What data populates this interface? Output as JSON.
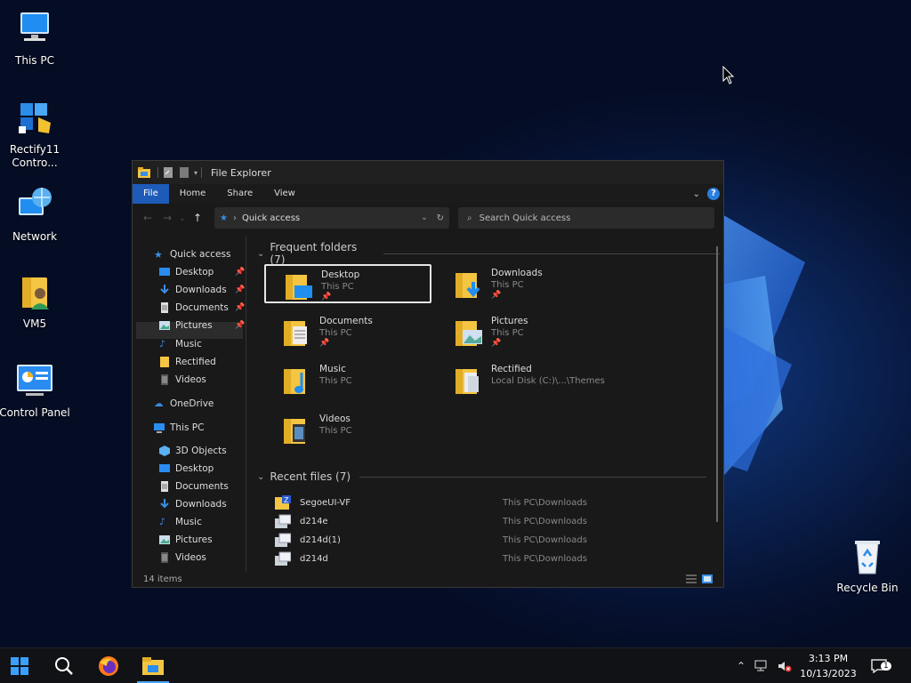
{
  "desktop": {
    "icons": [
      {
        "label": "This PC",
        "icon": "this-pc-icon"
      },
      {
        "label": "Rectify11 Contro...",
        "icon": "rectify11-control-center-icon"
      },
      {
        "label": "Network",
        "icon": "network-icon"
      },
      {
        "label": "VM5",
        "icon": "user-folder-icon"
      },
      {
        "label": "Control Panel",
        "icon": "control-panel-icon"
      },
      {
        "label": "Recycle Bin",
        "icon": "recycle-bin-icon"
      }
    ]
  },
  "explorer": {
    "title": "File Explorer",
    "ribbon_tabs": [
      "File",
      "Home",
      "Share",
      "View"
    ],
    "address": {
      "location": "Quick access"
    },
    "search": {
      "placeholder": "Search Quick access"
    },
    "nav": {
      "quick_access": "Quick access",
      "quick_items": [
        "Desktop",
        "Downloads",
        "Documents",
        "Pictures",
        "Music",
        "Rectified",
        "Videos"
      ],
      "onedrive": "OneDrive",
      "this_pc": "This PC",
      "this_pc_items": [
        "3D Objects",
        "Desktop",
        "Documents",
        "Downloads",
        "Music",
        "Pictures",
        "Videos"
      ]
    },
    "frequent": {
      "header": "Frequent folders (7)",
      "folders": [
        {
          "name": "Desktop",
          "location": "This PC",
          "pinned": true
        },
        {
          "name": "Downloads",
          "location": "This PC",
          "pinned": true
        },
        {
          "name": "Documents",
          "location": "This PC",
          "pinned": true
        },
        {
          "name": "Pictures",
          "location": "This PC",
          "pinned": true
        },
        {
          "name": "Music",
          "location": "This PC",
          "pinned": false
        },
        {
          "name": "Rectified",
          "location": "Local Disk (C:)\\...\\Themes",
          "pinned": false
        },
        {
          "name": "Videos",
          "location": "This PC",
          "pinned": false
        }
      ]
    },
    "recent": {
      "header": "Recent files (7)",
      "files": [
        {
          "name": "SegoeUI-VF",
          "path": "This PC\\Downloads"
        },
        {
          "name": "d214e",
          "path": "This PC\\Downloads"
        },
        {
          "name": "d214d(1)",
          "path": "This PC\\Downloads"
        },
        {
          "name": "d214d",
          "path": "This PC\\Downloads"
        }
      ]
    },
    "status": "14 items"
  },
  "taskbar": {
    "time": "3:13 PM",
    "date": "10/13/2023",
    "notification_count": "1"
  },
  "colors": {
    "accent": "#1e5bb8",
    "folder": "#f4c542"
  }
}
